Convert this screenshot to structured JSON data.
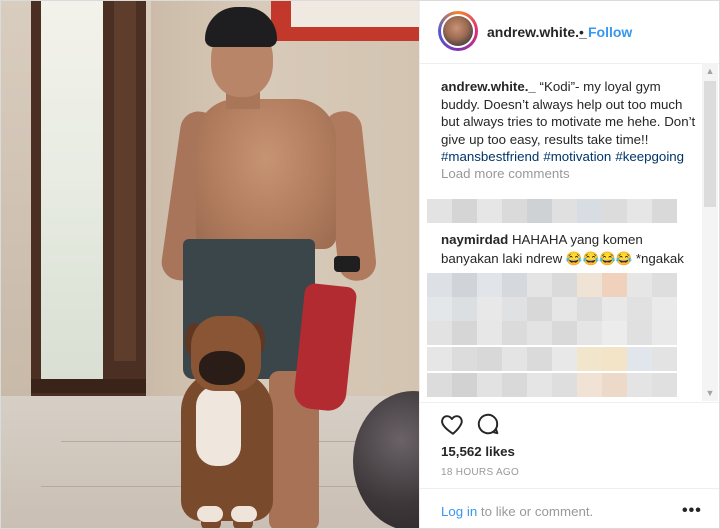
{
  "header": {
    "username": "andrew.white._",
    "separator": "•",
    "follow_label": "Follow"
  },
  "caption": {
    "username": "andrew.white._",
    "text": "“Kodi”- my loyal gym buddy. Doesn’t always help out too much but always tries to motivate me hehe. Don’t give up too easy, results take time!!",
    "hashtags": [
      "#mansbestfriend",
      "#motivation",
      "#keepgoing"
    ]
  },
  "comments": {
    "load_more_label": "Load more comments",
    "visible_comment": {
      "username": "naymirdad",
      "text": "HAHAHA yang komen banyakan laki ndrew 😂😂😂😂 *ngakak"
    }
  },
  "actions": {
    "like_icon": "heart-icon",
    "comment_icon": "comment-icon"
  },
  "stats": {
    "likes": "15,562 likes",
    "timestamp": "18 HOURS AGO"
  },
  "footer": {
    "login_link": "Log in",
    "login_suffix": " to like or comment.",
    "more_label": "•••"
  },
  "colors": {
    "link_blue": "#3897f0",
    "hashtag_blue": "#003569",
    "muted": "#999999",
    "text": "#262626"
  }
}
